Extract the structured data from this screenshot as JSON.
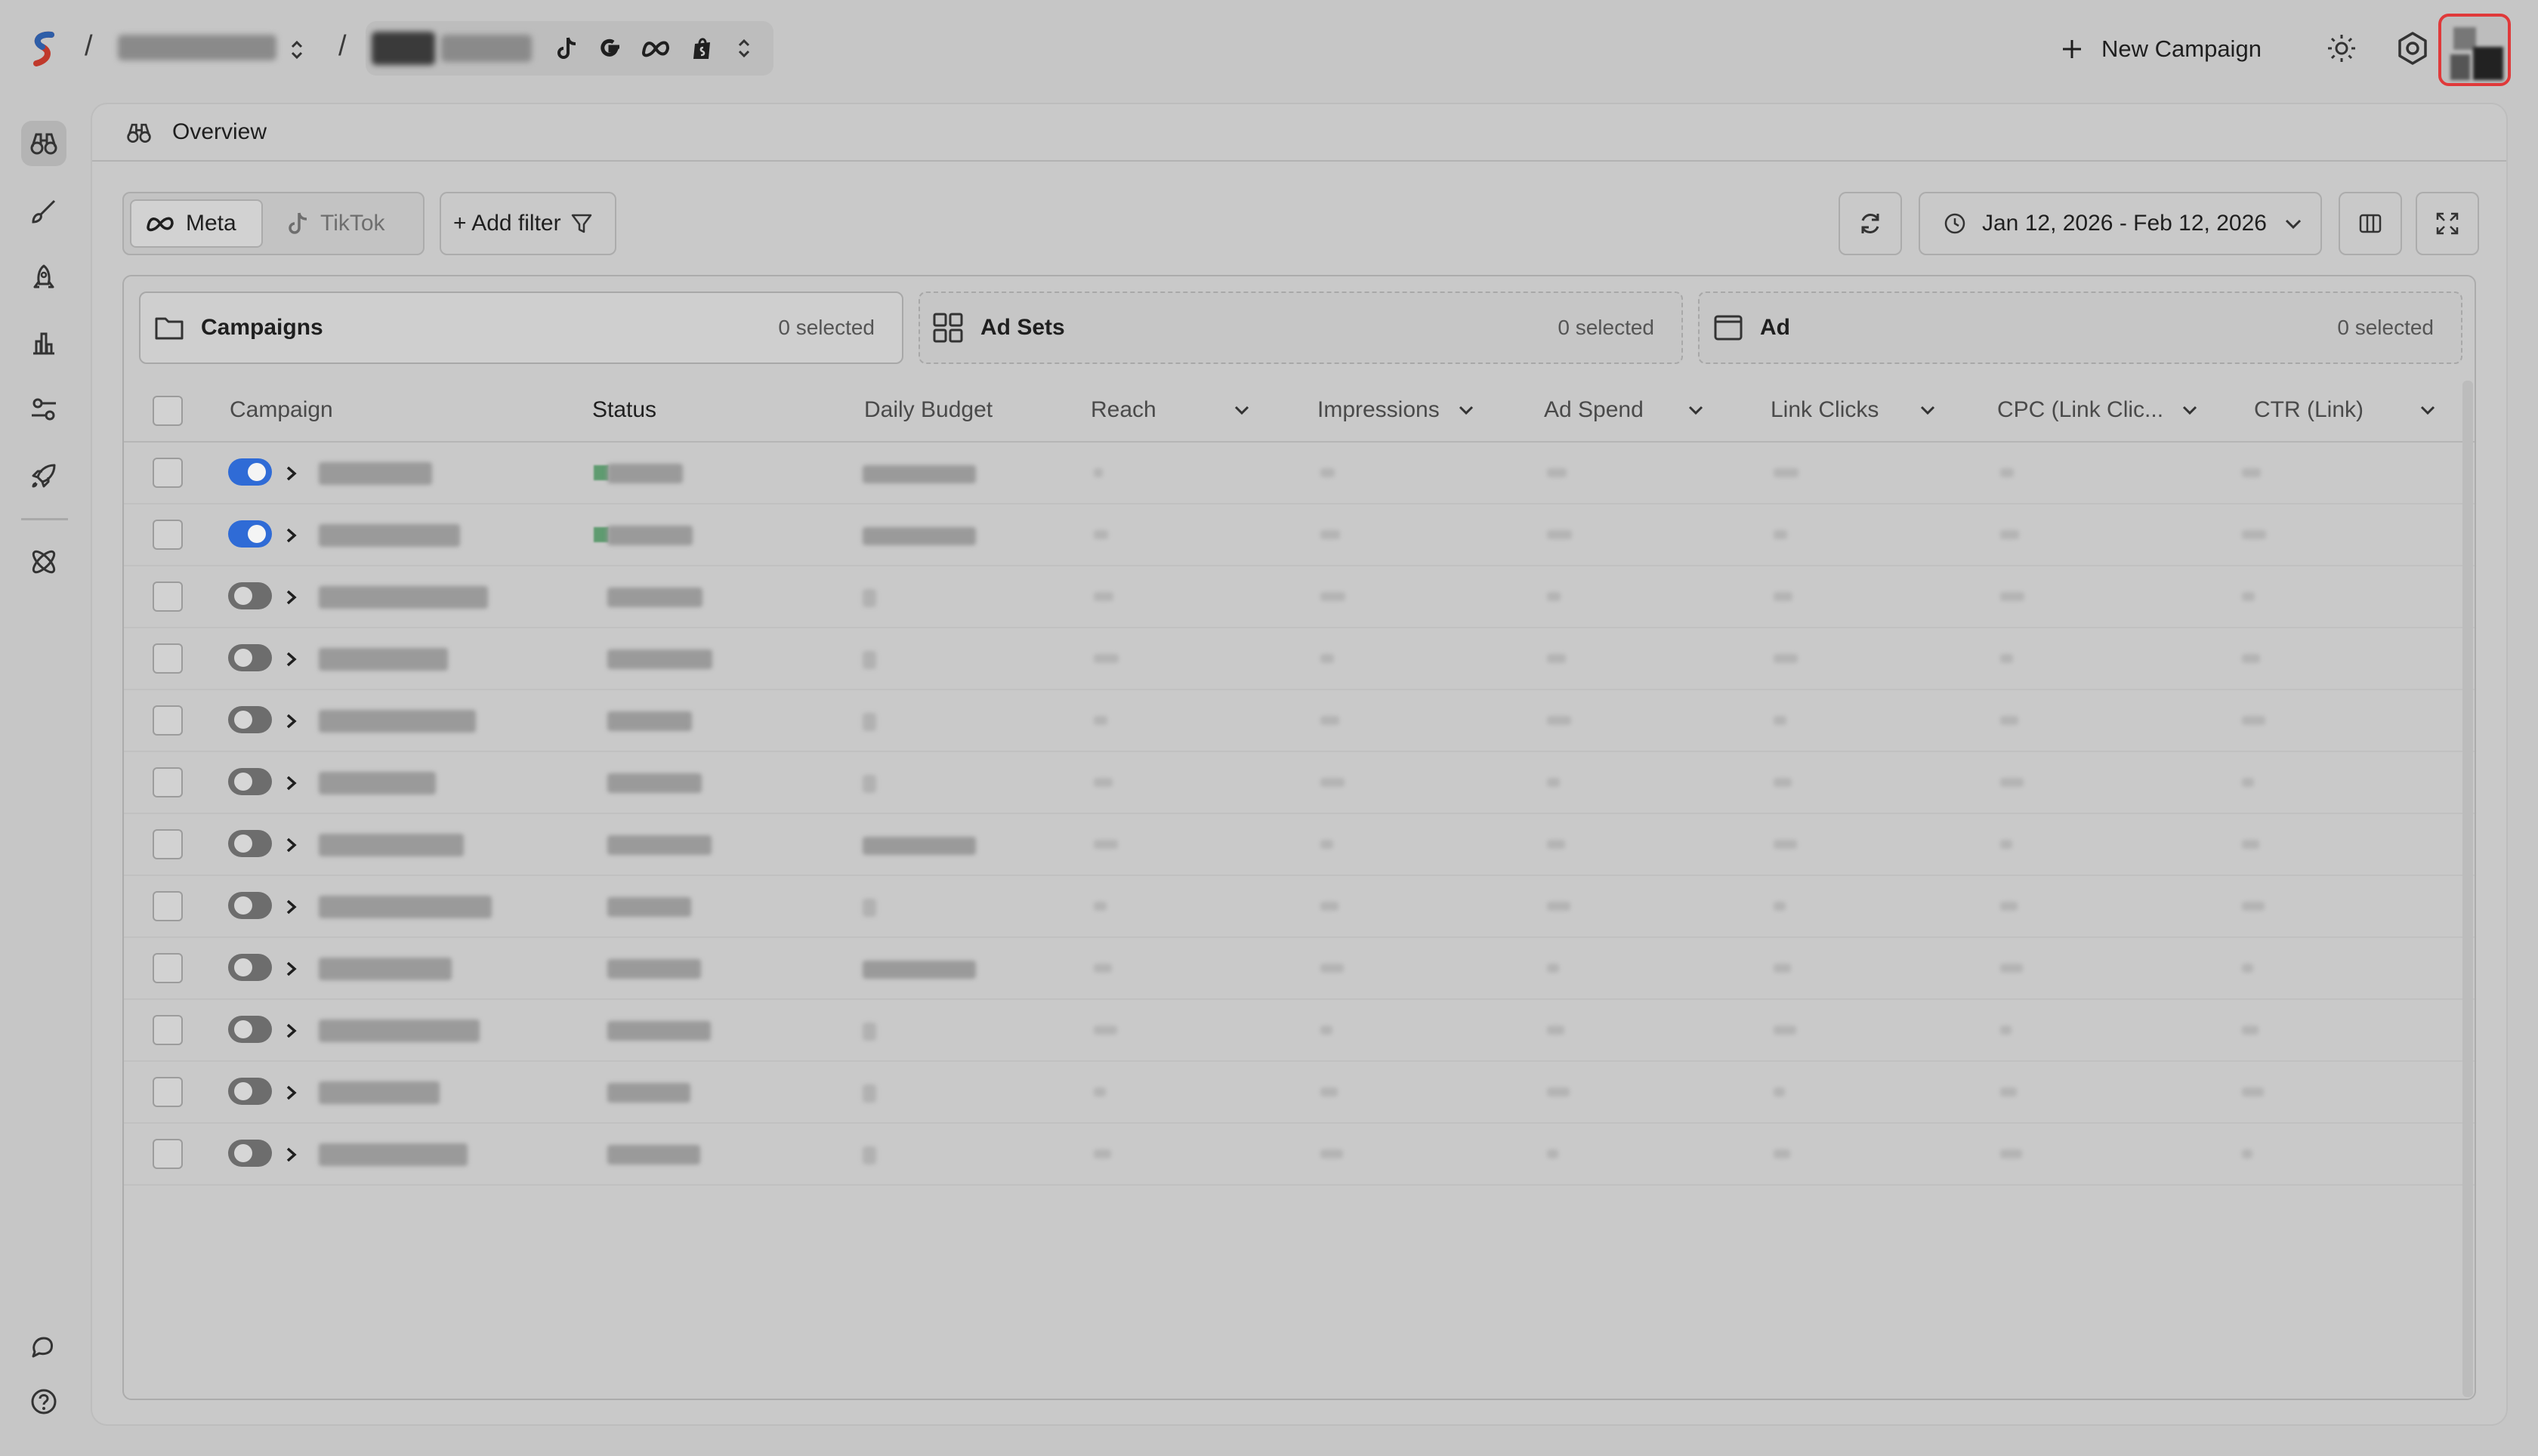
{
  "header": {
    "new_campaign_label": "New Campaign",
    "icons": [
      "sun-icon",
      "gear-icon"
    ]
  },
  "panel": {
    "title": "Overview"
  },
  "toolbar": {
    "platforms": [
      {
        "label": "Meta",
        "selected": true
      },
      {
        "label": "TikTok",
        "selected": false
      }
    ],
    "add_filter_label": "+ Add filter",
    "date_range": "Jan 12, 2026 - Feb 12, 2026"
  },
  "levels": [
    {
      "name": "Campaigns",
      "selected_text": "0 selected"
    },
    {
      "name": "Ad Sets",
      "selected_text": "0 selected"
    },
    {
      "name": "Ad",
      "selected_text": "0 selected"
    }
  ],
  "table": {
    "columns": [
      "Campaign",
      "Status",
      "Daily Budget",
      "Reach",
      "Impressions",
      "Ad Spend",
      "Link Clicks",
      "CPC (Link Clic...",
      "CTR (Link)"
    ],
    "rows": [
      {
        "active": true
      },
      {
        "active": true
      },
      {
        "active": false
      },
      {
        "active": false
      },
      {
        "active": false
      },
      {
        "active": false
      },
      {
        "active": false
      },
      {
        "active": false
      },
      {
        "active": false
      },
      {
        "active": false
      },
      {
        "active": false
      },
      {
        "active": false
      }
    ]
  },
  "colors": {
    "accent": "#2f6bd6",
    "highlight": "#e0393a",
    "status_active": "#5f9b70"
  }
}
